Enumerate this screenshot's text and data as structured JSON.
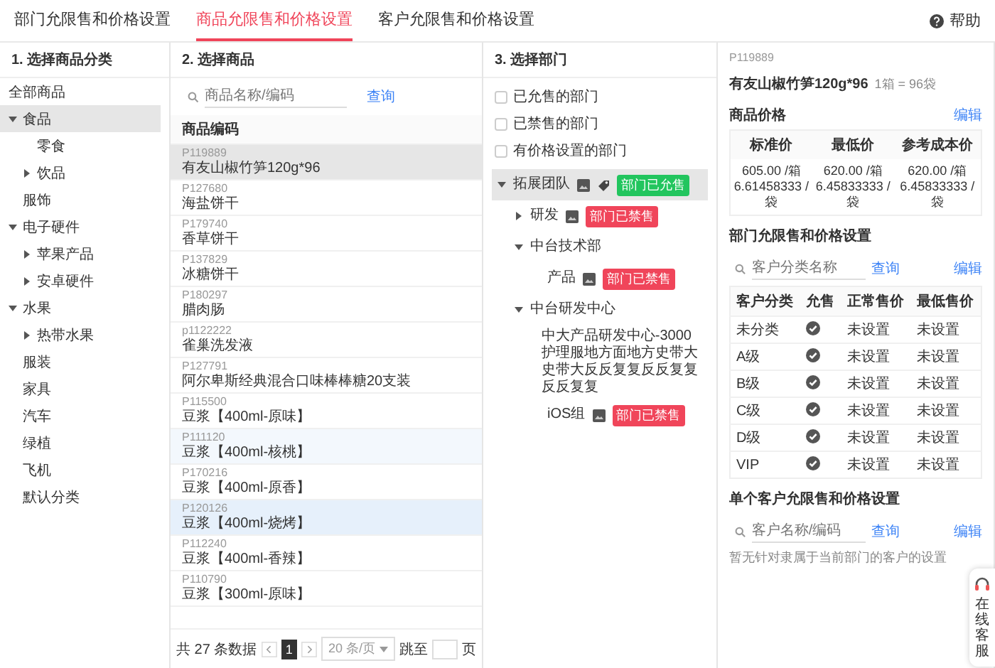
{
  "tabs": [
    {
      "label": "部门允限售和价格设置",
      "selected": false
    },
    {
      "label": "商品允限售和价格设置",
      "selected": true
    },
    {
      "label": "客户允限售和价格设置",
      "selected": false
    }
  ],
  "help": "帮助",
  "categories": {
    "title": "1. 选择商品分类",
    "root": "全部商品",
    "items": [
      {
        "label": "食品",
        "selected": true,
        "expanded": true,
        "children": [
          {
            "label": "零食",
            "selected": false
          },
          {
            "label": "饮品",
            "selected": false,
            "expanded": false
          }
        ]
      },
      {
        "label": "服饰",
        "selected": false
      },
      {
        "label": "电子硬件",
        "selected": false,
        "expanded": true,
        "children": [
          {
            "label": "苹果产品",
            "selected": false,
            "expanded": false
          },
          {
            "label": "安卓硬件",
            "selected": false,
            "expanded": false
          }
        ]
      },
      {
        "label": "水果",
        "selected": false,
        "expanded": true,
        "children": [
          {
            "label": "热带水果",
            "selected": false,
            "expanded": false
          }
        ]
      },
      {
        "label": "服装",
        "selected": false
      },
      {
        "label": "家具",
        "selected": false
      },
      {
        "label": "汽车",
        "selected": false
      },
      {
        "label": "绿植",
        "selected": false
      },
      {
        "label": "飞机",
        "selected": false
      },
      {
        "label": "默认分类",
        "selected": false
      }
    ]
  },
  "products": {
    "title": "2. 选择商品",
    "search_placeholder": "商品名称/编码",
    "search_button": "查询",
    "column": "商品编码",
    "rows": [
      {
        "code": "P119889",
        "name": "有友山椒竹笋120g*96",
        "selected": true,
        "hovered": false,
        "marked": false
      },
      {
        "code": "P127680",
        "name": "海盐饼干",
        "selected": false,
        "hovered": false,
        "marked": false
      },
      {
        "code": "P179740",
        "name": "香草饼干",
        "selected": false,
        "hovered": false,
        "marked": false
      },
      {
        "code": "P137829",
        "name": "冰糖饼干",
        "selected": false,
        "hovered": false,
        "marked": false
      },
      {
        "code": "P180297",
        "name": "腊肉肠",
        "selected": false,
        "hovered": false,
        "marked": false
      },
      {
        "code": "p1122222",
        "name": "雀巢洗发液",
        "selected": false,
        "hovered": false,
        "marked": false
      },
      {
        "code": "P127791",
        "name": "阿尔卑斯经典混合口味棒棒糖20支装",
        "selected": false,
        "hovered": false,
        "marked": false
      },
      {
        "code": "P115500",
        "name": "豆浆【400ml-原味】",
        "selected": false,
        "hovered": false,
        "marked": false
      },
      {
        "code": "P111120",
        "name": "豆浆【400ml-核桃】",
        "selected": false,
        "hovered": true,
        "marked": false
      },
      {
        "code": "P170216",
        "name": "豆浆【400ml-原香】",
        "selected": false,
        "hovered": false,
        "marked": false
      },
      {
        "code": "P120126",
        "name": "豆浆【400ml-烧烤】",
        "selected": false,
        "hovered": false,
        "marked": true
      },
      {
        "code": "P112240",
        "name": "豆浆【400ml-香辣】",
        "selected": false,
        "hovered": false,
        "marked": false
      },
      {
        "code": "P110790",
        "name": "豆浆【300ml-原味】",
        "selected": false,
        "hovered": false,
        "marked": false
      }
    ],
    "pagination": {
      "total": "共 27 条数据",
      "page": "1",
      "page_size": "20 条/页",
      "jump_label": "跳至",
      "jump_suffix": "页"
    }
  },
  "departments": {
    "title": "3. 选择部门",
    "filters": [
      {
        "label": "已允售的部门",
        "checked": false
      },
      {
        "label": "已禁售的部门",
        "checked": false
      },
      {
        "label": "有价格设置的部门",
        "checked": false
      }
    ],
    "tree": [
      {
        "label": "拓展团队",
        "selected": true,
        "expanded": true,
        "flag_icon": true,
        "tag": {
          "text": "部门已允售",
          "color": "#22c55e"
        },
        "children": [
          {
            "label": "研发",
            "selected": false,
            "expanded": false,
            "flag_icon": false,
            "tag": {
              "text": "部门已禁售",
              "color": "#f0455a"
            }
          },
          {
            "label": "中台技术部",
            "selected": false,
            "expanded": true,
            "children": [
              {
                "label": "产品",
                "selected": false,
                "flag_icon": false,
                "tag": {
                  "text": "部门已禁售",
                  "color": "#f0455a"
                }
              }
            ]
          },
          {
            "label": "中台研发中心",
            "selected": false,
            "expanded": true,
            "children": [
              {
                "label": "中大产品研发中心-3000护理服地方面地方史带大史带大反反复复反反复复反反复复",
                "selected": false
              },
              {
                "label": "iOS组",
                "selected": false,
                "flag_icon": false,
                "tag": {
                  "text": "部门已禁售",
                  "color": "#f0455a"
                }
              }
            ]
          }
        ]
      }
    ]
  },
  "detail": {
    "code": "P119889",
    "name": "有友山椒竹笋120g*96",
    "unit": "1箱 = 96袋",
    "prices": {
      "title": "商品价格",
      "edit": "编辑",
      "columns": [
        "标准价",
        "最低价",
        "参考成本价"
      ],
      "values": [
        [
          "605.00 /箱",
          "6.61458333 /袋"
        ],
        [
          "620.00 /箱",
          "6.45833333 /袋"
        ],
        [
          "620.00 /箱",
          "6.45833333 /袋"
        ]
      ]
    },
    "dept": {
      "title": "部门允限售和价格设置",
      "placeholder": "客户分类名称",
      "search": "查询",
      "edit": "编辑",
      "columns": [
        "客户分类",
        "允售",
        "正常售价",
        "最低售价"
      ],
      "rows": [
        {
          "category": "未分类",
          "allowed": true,
          "normal": "未设置",
          "lowest": "未设置"
        },
        {
          "category": "A级",
          "allowed": true,
          "normal": "未设置",
          "lowest": "未设置"
        },
        {
          "category": "B级",
          "allowed": true,
          "normal": "未设置",
          "lowest": "未设置"
        },
        {
          "category": "C级",
          "allowed": true,
          "normal": "未设置",
          "lowest": "未设置"
        },
        {
          "category": "D级",
          "allowed": true,
          "normal": "未设置",
          "lowest": "未设置"
        },
        {
          "category": "VIP",
          "allowed": true,
          "normal": "未设置",
          "lowest": "未设置"
        }
      ]
    },
    "customer": {
      "title": "单个客户允限售和价格设置",
      "placeholder": "客户名称/编码",
      "search": "查询",
      "edit": "编辑",
      "empty": "暂无针对隶属于当前部门的客户的设置"
    }
  },
  "service_widget": {
    "label": "在线客服"
  }
}
